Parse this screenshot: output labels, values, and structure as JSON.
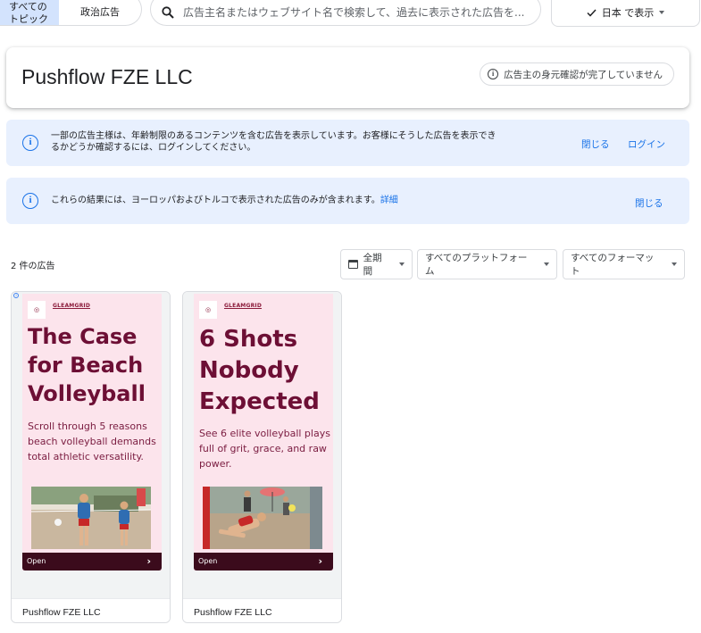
{
  "topics": {
    "all_label": "すべての\nトピック",
    "political_label": "政治広告"
  },
  "search": {
    "placeholder": "広告主名またはウェブサイト名で検索して、過去に表示された広告を..."
  },
  "region_button": {
    "label": "日本 で表示"
  },
  "advertiser": {
    "name": "Pushflow FZE LLC",
    "verification": "広告主の身元確認が完了していません"
  },
  "age_notice": {
    "text": "一部の広告主様は、年齢制限のあるコンテンツを含む広告を表示しています。お客様にそうした広告を表示でき\nるかどうか確認するには、ログインしてください。",
    "close": "閉じる",
    "login": "ログイン"
  },
  "region_notice": {
    "text": "これらの結果には、ヨーロッパおよびトルコで表示された広告のみが含まれます。",
    "details": "詳細",
    "close": "閉じる"
  },
  "results": {
    "count": "2 件の広告"
  },
  "filters": {
    "period": "全期間",
    "platform": "すべてのプラットフォーム",
    "format": "すべてのフォーマット"
  },
  "ads": [
    {
      "brand": "GLEAMGRID",
      "headline": "The Case for Beach Volleyball",
      "body": "Scroll through 5 reasons beach volleyball demands total athletic versatility.",
      "cta": "Open",
      "advertiser": "Pushflow FZE LLC"
    },
    {
      "brand": "GLEAMGRID",
      "headline": "6 Shots Nobody Expected",
      "body": "See 6 elite volleyball plays full of grit, grace, and raw power.",
      "cta": "Open",
      "advertiser": "Pushflow FZE LLC"
    }
  ],
  "colors": {
    "accent": "#1a73e8",
    "banner_bg": "#e8f0fe",
    "ad_bg": "#fce4ec",
    "ad_headline": "#6d0f35",
    "ad_cta_bg": "#3b0b1c"
  }
}
